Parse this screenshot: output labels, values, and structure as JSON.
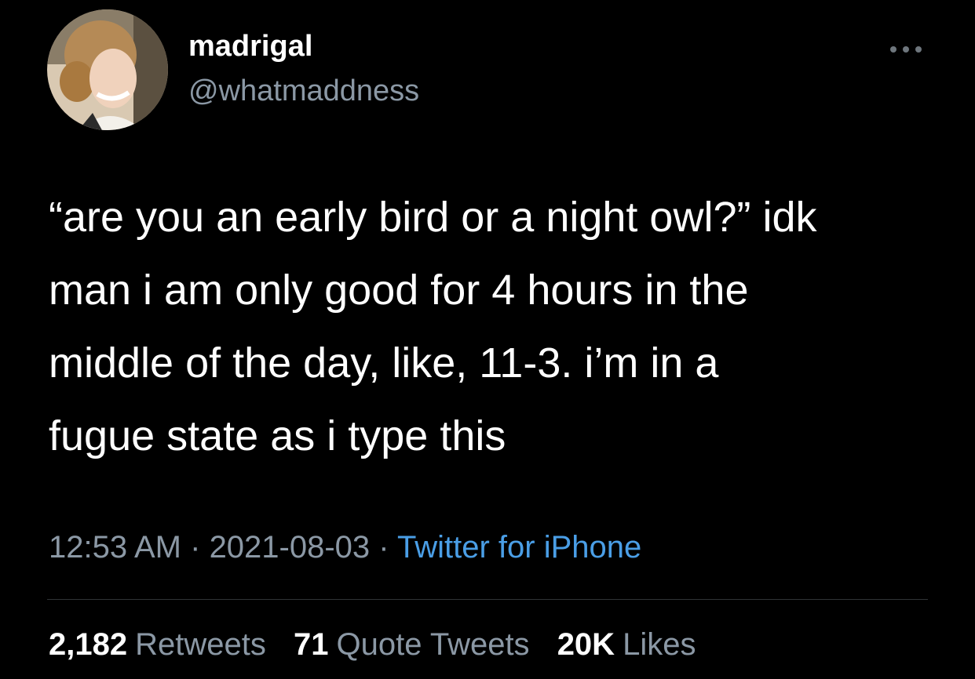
{
  "user": {
    "display_name": "madrigal",
    "handle": "@whatmaddness",
    "avatar_icon": "profile-photo"
  },
  "more_icon": "more-horizontal-icon",
  "tweet": {
    "lines": [
      "“are you an early bird or a night owl?” idk",
      "man i am only good for 4 hours in the",
      "middle of the day, like, 11-3. i’m in a",
      "fugue state as i type this"
    ]
  },
  "meta": {
    "time": "12:53 AM",
    "separator": " · ",
    "date": "2021-08-03",
    "source": "Twitter for iPhone"
  },
  "stats": {
    "retweets_count": "2,182",
    "retweets_label": "Retweets",
    "quotes_count": "71",
    "quotes_label": "Quote Tweets",
    "likes_count": "20K",
    "likes_label": "Likes"
  },
  "colors": {
    "background": "#000000",
    "text": "#ffffff",
    "secondary": "#8b98a5",
    "link": "#4a9ee6"
  }
}
